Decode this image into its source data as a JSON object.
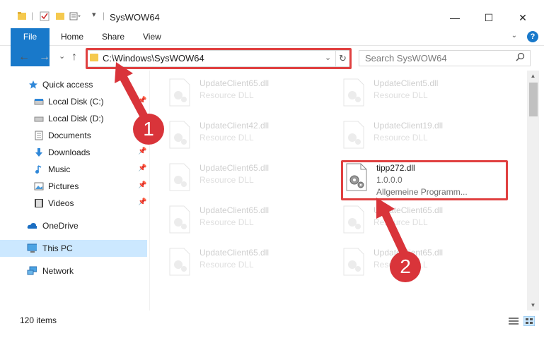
{
  "window": {
    "title": "SysWOW64",
    "minimize_icon": "minimize-icon",
    "maximize_icon": "maximize-icon",
    "close_icon": "close-icon",
    "minimize_glyph": "—",
    "maximize_glyph": "☐",
    "close_glyph": "✕"
  },
  "ribbon": {
    "tabs": [
      "File",
      "Home",
      "Share",
      "View"
    ],
    "collapse_glyph": "⌄",
    "help_glyph": "?"
  },
  "address": {
    "path": "C:\\Windows\\SysWOW64",
    "dropdown_glyph": "⌄",
    "refresh_glyph": "↻",
    "search_placeholder": "Search SysWOW64",
    "back_glyph": "←",
    "forward_glyph": "→",
    "recent_glyph": "⌄",
    "up_glyph": "↑"
  },
  "sidebar": {
    "items": [
      {
        "label": "Quick access",
        "icon": "star-icon",
        "pinned": false
      },
      {
        "label": "Local Disk (C:)",
        "icon": "drive-icon",
        "pinned": true
      },
      {
        "label": "Local Disk (D:)",
        "icon": "drive-icon",
        "pinned": false
      },
      {
        "label": "Documents",
        "icon": "documents-icon",
        "pinned": false
      },
      {
        "label": "Downloads",
        "icon": "download-icon",
        "pinned": true
      },
      {
        "label": "Music",
        "icon": "music-icon",
        "pinned": true
      },
      {
        "label": "Pictures",
        "icon": "pictures-icon",
        "pinned": true
      },
      {
        "label": "Videos",
        "icon": "videos-icon",
        "pinned": true
      },
      {
        "label": "OneDrive",
        "icon": "cloud-icon",
        "pinned": false
      },
      {
        "label": "This PC",
        "icon": "computer-icon",
        "pinned": false,
        "selected": true
      },
      {
        "label": "Network",
        "icon": "network-icon",
        "pinned": false
      }
    ],
    "pin_glyph": "📌"
  },
  "files": [
    {
      "name": "UpdateClient65.dll",
      "desc": "Resource DLL"
    },
    {
      "name": "UpdateClient5.dll",
      "desc": "Resource DLL"
    },
    {
      "name": "UpdateClient42.dll",
      "desc": "Resource DLL"
    },
    {
      "name": "UpdateClient19.dll",
      "desc": "Resource DLL"
    },
    {
      "name": "UpdateClient65.dll",
      "desc": "Resource DLL"
    },
    {
      "name": "tipp272.dll",
      "desc": "1.0.0.0",
      "desc2": "Allgemeine Programm..."
    },
    {
      "name": "UpdateClient65.dll",
      "desc": "Resource DLL"
    },
    {
      "name": "UpdateClient65.dll",
      "desc": "Resource DLL"
    },
    {
      "name": "UpdateClient65.dll",
      "desc": "Resource DLL"
    },
    {
      "name": "UpdateClient65.dll",
      "desc": "Resource DLL"
    }
  ],
  "status": {
    "count": "120 items"
  },
  "callouts": [
    "1",
    "2"
  ],
  "colors": {
    "accent": "#1979ca",
    "highlight": "#e04040",
    "callout": "#d9343a",
    "selected": "#cce8ff"
  }
}
